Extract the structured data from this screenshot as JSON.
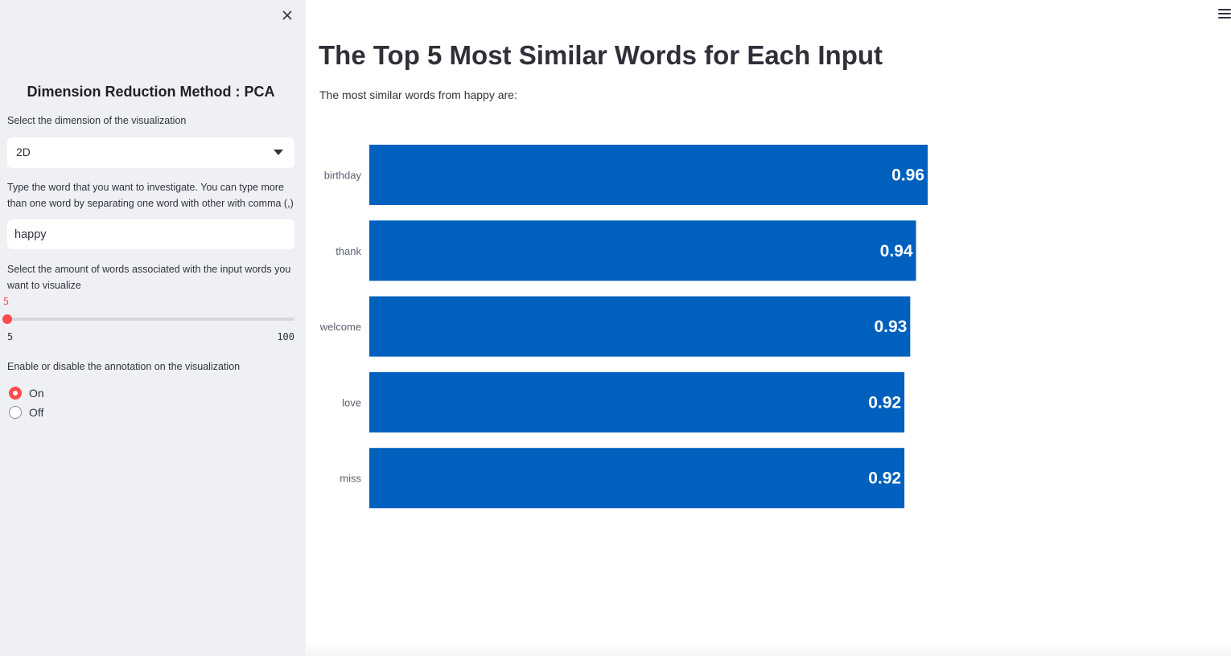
{
  "sidebar": {
    "close_icon": "close-icon",
    "title": "Dimension Reduction Method : PCA",
    "dimension_label": "Select the dimension of the visualization",
    "dimension_value": "2D",
    "word_label": "Type the word that you want to investigate. You can type more than one word by separating one word with other with comma (,)",
    "word_value": "happy",
    "amount_label": "Select the amount of words associated with the input words you want to visualize",
    "slider": {
      "value": "5",
      "min": "5",
      "max": "100"
    },
    "annotation_label": "Enable or disable the annotation on the visualization",
    "annotation_options": [
      "On",
      "Off"
    ],
    "annotation_selected": "On"
  },
  "header": {
    "menu_icon": "hamburger-menu-icon"
  },
  "main": {
    "title": "The Top 5 Most Similar Words for Each Input",
    "subtitle": "The most similar words from happy are:"
  },
  "colors": {
    "bar": "#0060be",
    "accent": "#ff4b4b",
    "sidebar_bg": "#eef0f4"
  },
  "chart_data": {
    "type": "bar",
    "orientation": "horizontal",
    "categories": [
      "birthday",
      "thank",
      "welcome",
      "love",
      "miss"
    ],
    "values": [
      0.96,
      0.94,
      0.93,
      0.92,
      0.92
    ],
    "labels": [
      "0.96",
      "0.94",
      "0.93",
      "0.92",
      "0.92"
    ],
    "xlim": [
      0,
      0.96
    ],
    "grid": false
  }
}
